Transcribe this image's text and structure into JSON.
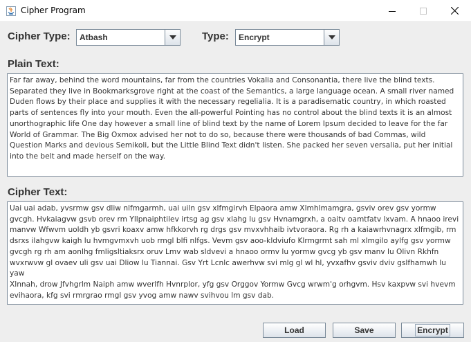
{
  "window": {
    "title": "Cipher Program"
  },
  "form": {
    "cipher_type_label": "Cipher Type:",
    "cipher_type_value": "Atbash",
    "type_label": "Type:",
    "type_value": "Encrypt",
    "plain_label": "Plain Text:",
    "plain_text": "Far far away, behind the word mountains, far from the countries Vokalia and Consonantia, there live the blind texts.\nSeparated they live in Bookmarksgrove right at the coast of the Semantics, a large language ocean. A small river named\nDuden flows by their place and supplies it with the necessary regelialia. It is a paradisematic country, in which roasted\nparts of sentences fly into your mouth. Even the all-powerful Pointing has no control about the blind texts it is an almost\nunorthographic life One day however a small line of blind text by the name of Lorem Ipsum decided to leave for the far\nWorld of Grammar. The Big Oxmox advised her not to do so, because there were thousands of bad Commas, wild\nQuestion Marks and devious Semikoli, but the Little Blind Text didn't listen. She packed her seven versalia, put her initial\ninto the belt and made herself on the way.",
    "cipher_label": "Cipher Text:",
    "cipher_text": "Uai uai adab, yvsrmw gsv dliw nlfmgarmh, uai uiln gsv xlfmgirvh Elpaora amw Xlmhlmamgra, gsviv orev gsv yormw\ngvcgh. Hvkaiagvw gsvb orev rm Yllpnaiphtilev irtsg ag gsv xlahg lu gsv Hvnamgrxh, a oaitv oamtfatv lxvam. A hnaoo irevi\nmanvw Wfwvm uoldh yb gsvri koaxv amw hfkkorvh rg drgs gsv mvxvhhaib ivtvoraora. Rg rh a kaiawrhvnagrx xlfmgib, rm\ndsrxs ilahgvw kaigh lu hvmgvmxvh uob rmgl blfi nlfgs. Vevm gsv aoo-kldviufo Klrmgrmt sah ml xlmgilo aylfg gsv yormw\ngvcgh rg rh am aonlhg fmligsltiaksrx oruv Lmv wab sldvevi a hnaoo ormv lu yormw gvcg yb gsv manv lu Olivn Rkhfn\nwvxrwvw gl ovaev uli gsv uai Dliow lu Tiannai. Gsv Yrt Lcnlc awerhvw svi mlg gl wl hl, yvxafhv gsviv dviv gslfhamwh lu yaw\nXlnnah, drow Jfvhgrlm Naiph amw wverlfh Hvnrplor, yfg gsv Orggov Yormw Gvcg wrwm'g orhgvm. Hsv kaxpvw svi hvevm\nevihaora, kfg svi rmrgrao rmgl gsv yvog amw nawv svihvou lm gsv dab."
  },
  "buttons": {
    "load": "Load",
    "save": "Save",
    "encrypt": "Encrypt"
  }
}
